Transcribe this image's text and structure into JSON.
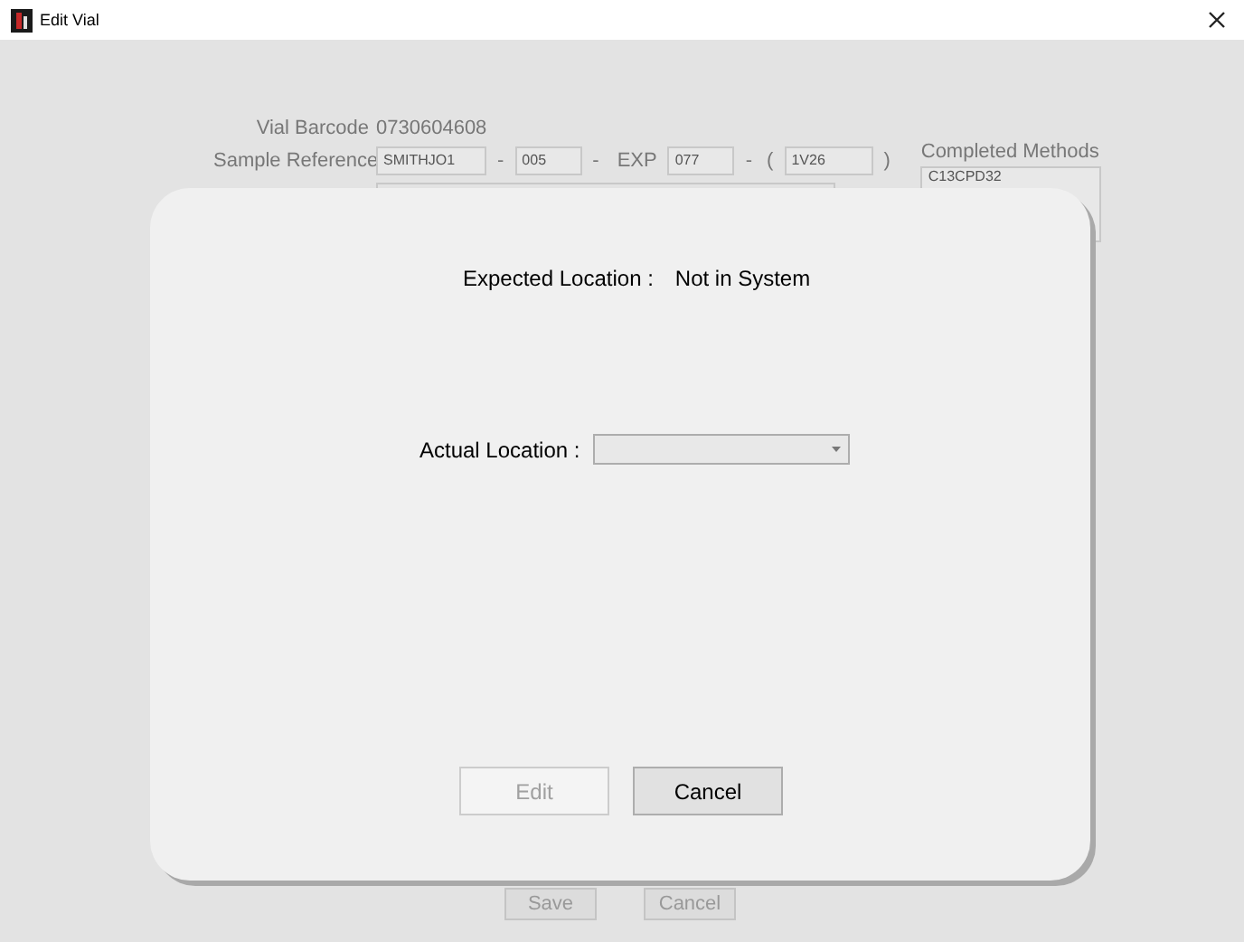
{
  "window": {
    "title": "Edit Vial"
  },
  "form": {
    "vial_barcode": {
      "label": "Vial Barcode",
      "value": "0730604608"
    },
    "sample_reference": {
      "label": "Sample Reference",
      "parts": [
        {
          "kind": "field",
          "value": "SMITHJO1"
        },
        {
          "kind": "sep",
          "text": "-"
        },
        {
          "kind": "field",
          "value": "005"
        },
        {
          "kind": "sep",
          "text": "-"
        },
        {
          "kind": "label",
          "text": "EXP"
        },
        {
          "kind": "field",
          "value": "077"
        },
        {
          "kind": "sep",
          "text": "-"
        },
        {
          "kind": "sep",
          "text": "("
        },
        {
          "kind": "field",
          "value": "1V26"
        },
        {
          "kind": "sep",
          "text": ")"
        }
      ]
    },
    "completed_methods": {
      "label": "Completed Methods",
      "items": [
        "C13CPD32"
      ]
    },
    "buttons": [
      {
        "label": "Save"
      },
      {
        "label": "Cancel"
      }
    ]
  },
  "dialog": {
    "expected_location": {
      "label": "Expected Location :",
      "value": "Not in System"
    },
    "actual_location": {
      "label": "Actual Location :"
    },
    "buttons": [
      {
        "label": "Edit",
        "disabled": true
      },
      {
        "label": "Cancel",
        "disabled": false
      }
    ]
  }
}
